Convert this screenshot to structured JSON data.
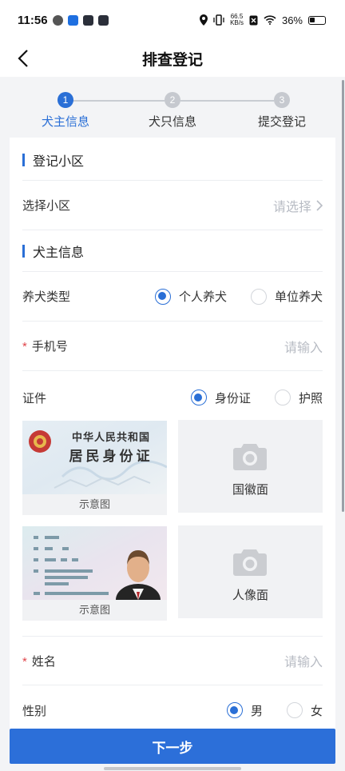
{
  "status_bar": {
    "time": "11:56",
    "net_speed_value": "66.5",
    "net_speed_unit": "KB/s",
    "battery": "36%"
  },
  "nav": {
    "title": "排查登记"
  },
  "steps": [
    {
      "num": "1",
      "label": "犬主信息",
      "active": true
    },
    {
      "num": "2",
      "label": "犬只信息",
      "active": false
    },
    {
      "num": "3",
      "label": "提交登记",
      "active": false
    }
  ],
  "form": {
    "section_community": "登记小区",
    "community_label": "选择小区",
    "community_placeholder": "请选择",
    "section_owner": "犬主信息",
    "keeping_type_label": "养犬类型",
    "keeping_type_options": [
      "个人养犬",
      "单位养犬"
    ],
    "keeping_type_selected": "个人养犬",
    "phone_label": "手机号",
    "phone_placeholder": "请输入",
    "cert_label": "证件",
    "cert_options": [
      "身份证",
      "护照"
    ],
    "cert_selected": "身份证",
    "id_front_sample": {
      "line1": "中华人民共和国",
      "line2": "居民身份证",
      "caption": "示意图"
    },
    "id_front_upload_label": "国徽面",
    "id_back_sample": {
      "caption": "示意图"
    },
    "id_back_upload_label": "人像面",
    "name_label": "姓名",
    "name_placeholder": "请输入",
    "gender_label": "性别",
    "gender_options": [
      "男",
      "女"
    ],
    "gender_selected": "男"
  },
  "footer": {
    "next_label": "下一步"
  },
  "colors": {
    "accent": "#2a6fd6",
    "required": "#e0454a",
    "placeholder": "#b8bcc4"
  }
}
